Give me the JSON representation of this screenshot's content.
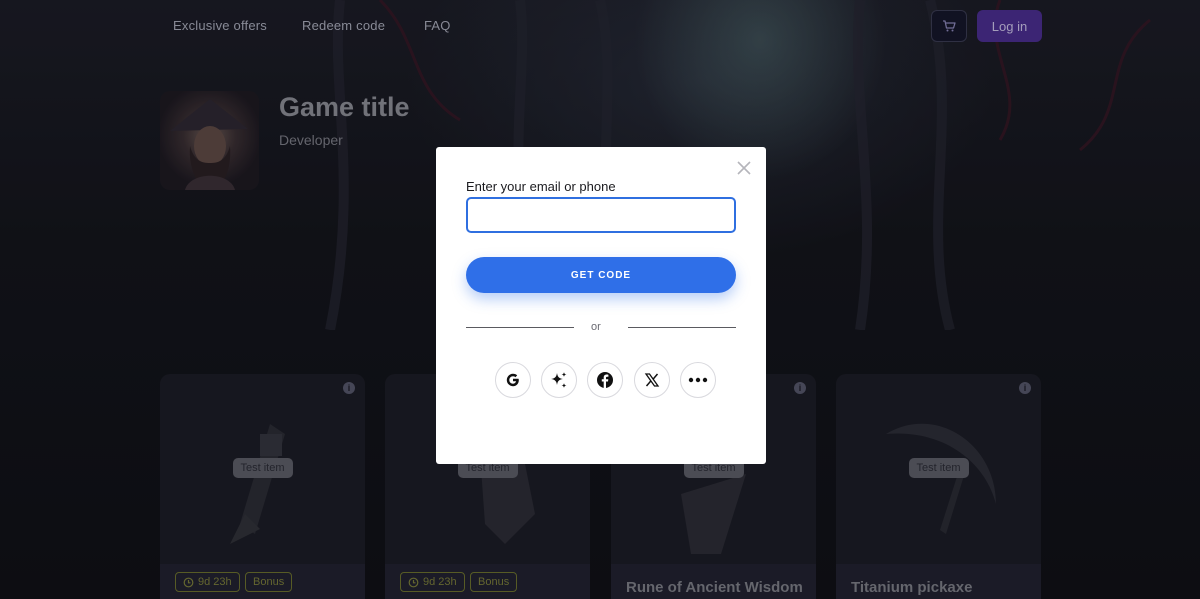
{
  "nav": {
    "links": [
      "Exclusive offers",
      "Redeem code",
      "FAQ"
    ],
    "login_label": "Log in",
    "cart_icon": "cart-icon"
  },
  "game": {
    "title": "Game title",
    "developer": "Developer"
  },
  "cards": [
    {
      "badge": "Test item",
      "tags": [
        "9d 23h",
        "Bonus"
      ],
      "name": ""
    },
    {
      "badge": "Test item",
      "tags": [
        "9d 23h",
        "Bonus"
      ],
      "name": ""
    },
    {
      "badge": "Test item",
      "tags": [],
      "name": "Rune of Ancient Wisdom"
    },
    {
      "badge": "Test item",
      "tags": [],
      "name": "Titanium pickaxe"
    }
  ],
  "modal": {
    "label": "Enter your email or phone",
    "input_value": "",
    "button": "GET CODE",
    "or": "or",
    "social": [
      "google-icon",
      "sparkle-icon",
      "facebook-icon",
      "x-icon",
      "more-icon"
    ]
  },
  "colors": {
    "accent": "#2f6fe8",
    "login_button": "#4a2e8e",
    "tag": "#6b6f2e"
  }
}
